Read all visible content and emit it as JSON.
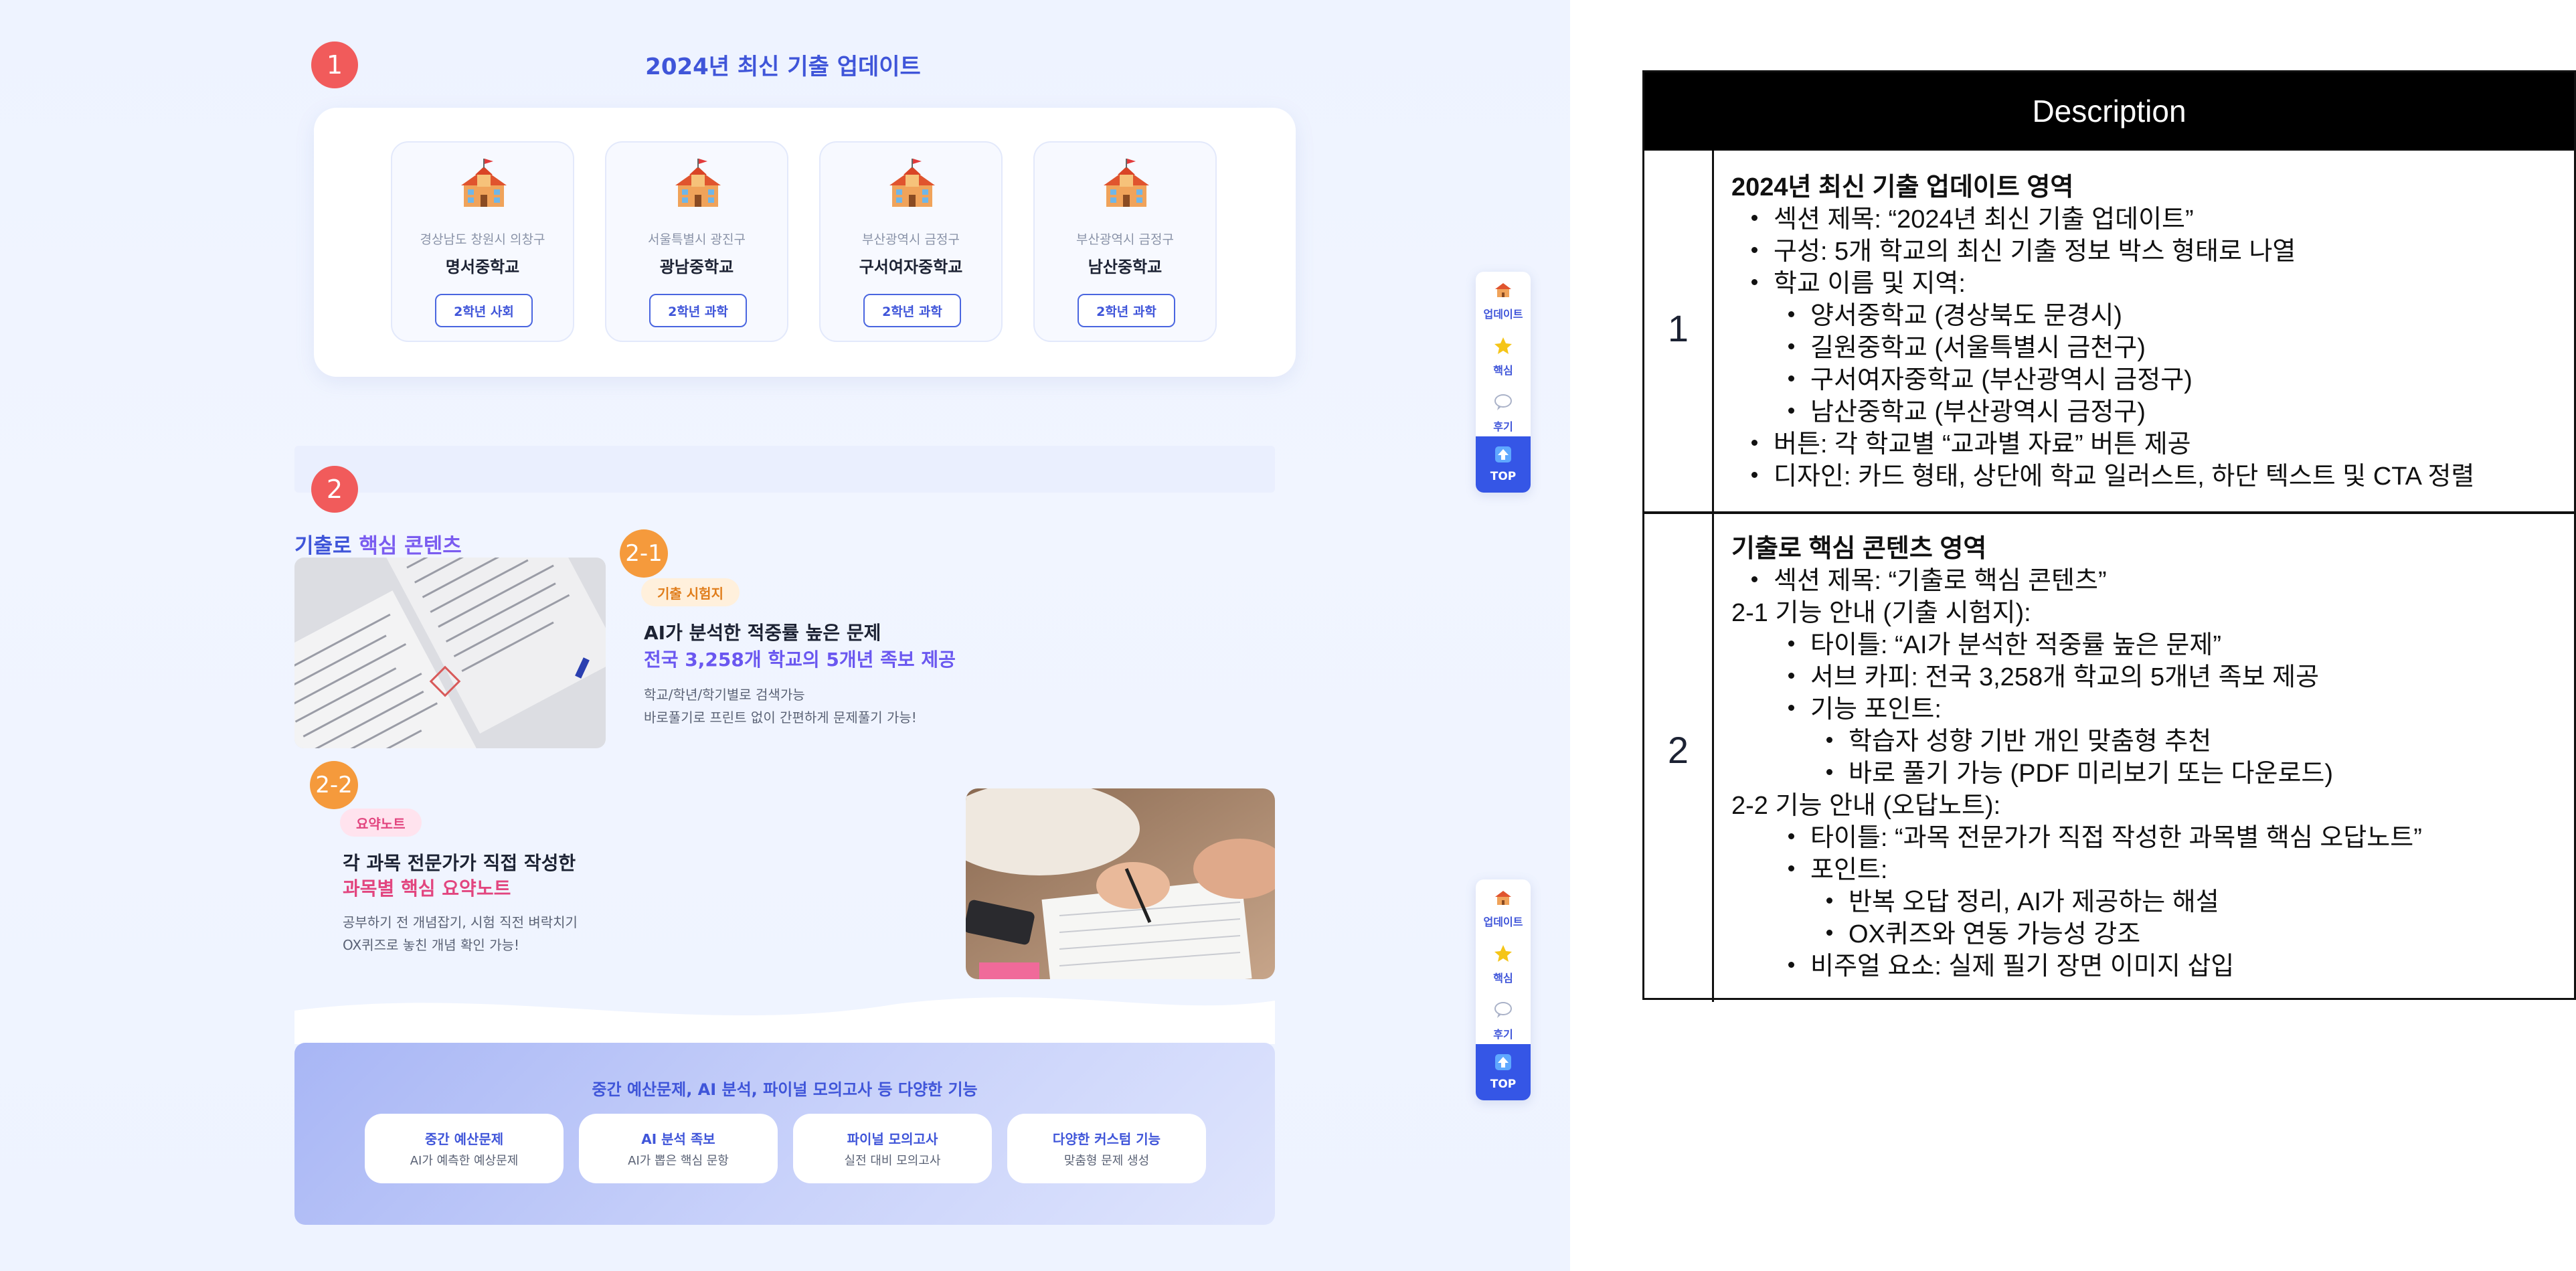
{
  "section1": {
    "badge": "1",
    "title": "2024년 최신 기출 업데이트",
    "schools": [
      {
        "region": "경상남도 창원시 의창구",
        "name": "명서중학교",
        "button": "2학년 사회"
      },
      {
        "region": "서울특별시 광진구",
        "name": "광남중학교",
        "button": "2학년 과학"
      },
      {
        "region": "부산광역시 금정구",
        "name": "구서여자중학교",
        "button": "2학년 과학"
      },
      {
        "region": "부산광역시 금정구",
        "name": "남산중학교",
        "button": "2학년 과학"
      }
    ]
  },
  "section2": {
    "badge": "2",
    "title_part1": "기출로",
    "title_part2": " 핵심 콘텐츠",
    "feature1": {
      "badge": "2-1",
      "tag": "기출 시험지",
      "title": "AI가 분석한 적중률 높은 문제",
      "subtitle": "전국 3,258개 학교의 5개년 족보 제공",
      "body": [
        "학교/학년/학기별로 검색가능",
        "바로풀기로 프린트 없이 간편하게 문제풀기 가능!"
      ]
    },
    "feature2": {
      "badge": "2-2",
      "tag": "요약노트",
      "title": "각 과목 전문가가 직접 작성한",
      "subtitle": "과목별 핵심 요약노트",
      "body": [
        "공부하기 전 개념잡기, 시험 직전 벼락치기",
        "OX퀴즈로 놓친 개념 확인 가능!"
      ]
    },
    "features_panel": {
      "title": "중간 예산문제, AI 분석, 파이널 모의고사 등 다양한 기능",
      "cards": [
        {
          "name": "중간 예산문제",
          "desc": "AI가 예측한 예상문제"
        },
        {
          "name": "AI 분석 족보",
          "desc": "AI가 뽑은 핵심 문항"
        },
        {
          "name": "파이널 모의고사",
          "desc": "실전 대비 모의고사"
        },
        {
          "name": "다양한 커스텀 기능",
          "desc": "맞춤형 문제 생성"
        }
      ]
    }
  },
  "side_nav": {
    "items": [
      "업데이트",
      "핵심",
      "후기"
    ],
    "top": "TOP"
  },
  "description": {
    "header": "Description",
    "rows": [
      {
        "num": "1",
        "lines": [
          "2024년 최신 기출 업데이트 영역",
          "섹션 제목: “2024년 최신 기출 업데이트”",
          "구성: 5개 학교의 최신 기출 정보 박스 형태로 나열",
          "학교 이름 및 지역:",
          "양서중학교 (경상북도 문경시)",
          "길원중학교 (서울특별시 금천구)",
          "구서여자중학교 (부산광역시 금정구)",
          "남산중학교 (부산광역시 금정구)",
          "버튼: 각 학교별 “교과별 자료” 버튼 제공",
          "디자인: 카드 형태, 상단에 학교 일러스트, 하단 텍스트 및 CTA 정렬"
        ]
      },
      {
        "num": "2",
        "lines": [
          "기출로 핵심 콘텐츠 영역",
          "섹션 제목: “기출로 핵심 콘텐츠”",
          "2-1 기능 안내  (기출 시험지):",
          "타이틀: “AI가 분석한 적중률 높은 문제”",
          "서브 카피: 전국 3,258개 학교의 5개년 족보 제공",
          "기능 포인트:",
          "학습자 성향 기반 개인 맞춤형 추천",
          "바로 풀기 가능 (PDF 미리보기 또는 다운로드)",
          "2-2 기능 안내  (오답노트):",
          "타이틀: “과목 전문가가 직접 작성한 과목별 핵심 오답노트”",
          "포인트:",
          "반복 오답 정리, AI가 제공하는 해설",
          "OX퀴즈와 연동 가능성 강조",
          "비주얼 요소: 실제 필기 장면 이미지 삽입"
        ]
      }
    ]
  },
  "colors": {
    "primary": "#3f55d9",
    "badge_red": "#f15b5b",
    "badge_orange": "#f59a3c",
    "accent_purple": "#7a5cf0",
    "accent_pink": "#e2457f"
  }
}
